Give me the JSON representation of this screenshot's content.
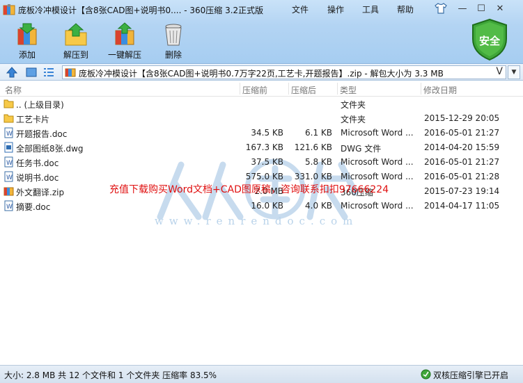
{
  "window": {
    "title": "庞板冷冲模设计【含8张CAD图+说明书0.... - 360压缩 3.2正式版",
    "menu": [
      "文件",
      "操作",
      "工具",
      "帮助"
    ],
    "controls": {
      "minimize": "—",
      "maximize": "☐",
      "close": "✕"
    }
  },
  "toolbar": {
    "buttons": [
      {
        "label": "添加",
        "icon": "add-archive-icon"
      },
      {
        "label": "解压到",
        "icon": "extract-folder-icon"
      },
      {
        "label": "一键解压",
        "icon": "one-click-extract-icon"
      },
      {
        "label": "删除",
        "icon": "trash-icon"
      }
    ],
    "security_badge": "安全"
  },
  "pathbar": {
    "address": "庞板冷冲模设计【含8张CAD图+说明书0.7万字22页,工艺卡,开题报告】.zip - 解包大小为 3.3 MB",
    "dropdown_glyph": "V"
  },
  "list": {
    "columns": [
      "名称",
      "压缩前",
      "压缩后",
      "类型",
      "修改日期"
    ],
    "rows": [
      {
        "name": ".. (上级目录)",
        "before": "",
        "after": "",
        "type": "文件夹",
        "date": "",
        "icon": "folder"
      },
      {
        "name": "工艺卡片",
        "before": "",
        "after": "",
        "type": "文件夹",
        "date": "2015-12-29 20:05",
        "icon": "folder"
      },
      {
        "name": "开题报告.doc",
        "before": "34.5 KB",
        "after": "6.1 KB",
        "type": "Microsoft Word ...",
        "date": "2016-05-01 21:27",
        "icon": "doc"
      },
      {
        "name": "全部图纸8张.dwg",
        "before": "167.3 KB",
        "after": "121.6 KB",
        "type": "DWG 文件",
        "date": "2014-04-20 15:59",
        "icon": "dwg"
      },
      {
        "name": "任务书.doc",
        "before": "37.5 KB",
        "after": "5.8 KB",
        "type": "Microsoft Word ...",
        "date": "2016-05-01 21:27",
        "icon": "doc"
      },
      {
        "name": "说明书.doc",
        "before": "575.0 KB",
        "after": "331.0 KB",
        "type": "Microsoft Word ...",
        "date": "2016-05-01 21:28",
        "icon": "doc"
      },
      {
        "name": "外文翻译.zip",
        "before": "2.0 MB",
        "after": "",
        "type": "360压缩",
        "date": "2015-07-23 19:14",
        "icon": "zip"
      },
      {
        "name": "摘要.doc",
        "before": "16.0 KB",
        "after": "4.0 KB",
        "type": "Microsoft Word ...",
        "date": "2014-04-17 11:05",
        "icon": "doc"
      }
    ]
  },
  "watermark": {
    "red_text": "充值下载购买Word文档+CAD图原稿，咨询联系扣扣97666224",
    "url_text": "www.renrendoc.com"
  },
  "statusbar": {
    "summary": "大小: 2.8 MB 共 12 个文件和 1 个文件夹 压缩率 83.5%",
    "engine": "双核压缩引擎已开启"
  },
  "colors": {
    "accent": "#2a7bd3",
    "security_green": "#3fa63a",
    "watermark_red": "#e01010"
  }
}
